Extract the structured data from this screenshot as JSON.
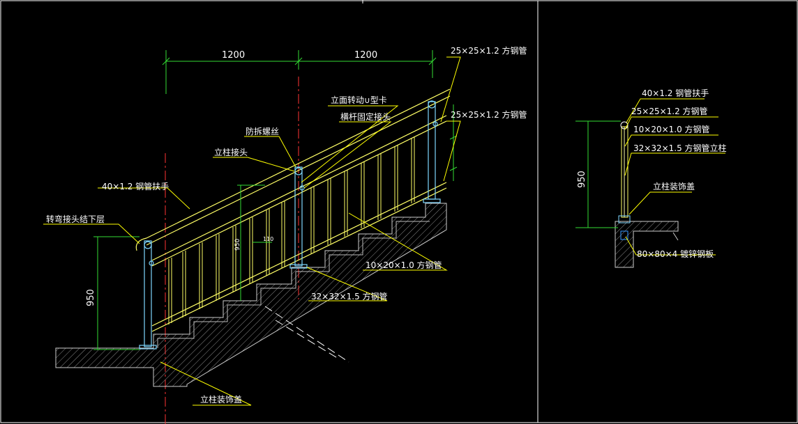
{
  "colors": {
    "background": "#000000",
    "frame": "#ffffff",
    "handrail": "#ffff66",
    "balusters": "#ffff66",
    "posts": "#7fd7ff",
    "dimension": "#33dd33",
    "leader": "#ffff00",
    "concrete": "#9a9a9a",
    "centerline": "#ff3333"
  },
  "elevation": {
    "dim_top_left": "1200",
    "dim_top_right": "1200",
    "dim_height": "950",
    "dim_post_height": "950",
    "dim_spacing": "110",
    "labels": {
      "tube_25_top": "25×25×1.2 方钢管",
      "tube_25_mid": "25×25×1.2 方钢管",
      "rotating_clip": "立面转动∪型卡",
      "rail_joint": "横杆固定接头",
      "anti_loose_screw": "防拆螺丝",
      "post_joint": "立柱接头",
      "handrail_40": "40×1.2 钢管扶手",
      "elbow_joint": "转弯接头结下层",
      "tube_10x20": "10×20×1.0 方钢管",
      "tube_32x32": "32×32×1.5 方钢管",
      "post_cover": "立柱装饰盖"
    }
  },
  "section": {
    "dim_height": "950",
    "labels": {
      "handrail_40": "40×1.2 钢管扶手",
      "tube_25": "25×25×1.2 方钢管",
      "tube_10x20": "10×20×1.0 方钢管",
      "post_32x32": "32×32×1.5 方钢管立柱",
      "post_cover": "立柱装饰盖",
      "base_plate": "80×80×4 镀锌钢板"
    }
  }
}
